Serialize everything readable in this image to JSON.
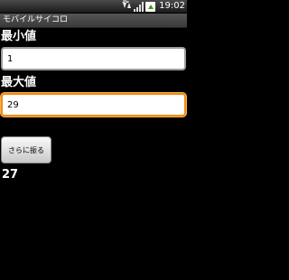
{
  "status_bar": {
    "network_label": "3G",
    "time": "19:02"
  },
  "app": {
    "title": "モバイルサイコロ"
  },
  "form": {
    "min_label": "最小値",
    "min_value": "1",
    "max_label": "最大値",
    "max_value": "29",
    "roll_button_label": "さらに振る"
  },
  "result": {
    "value": "27"
  },
  "colors": {
    "focus_border": "#f08a16",
    "background": "#000000"
  },
  "icons": {
    "network": "network-activity-icon",
    "signal": "signal-strength-icon",
    "battery": "battery-charging-icon"
  }
}
